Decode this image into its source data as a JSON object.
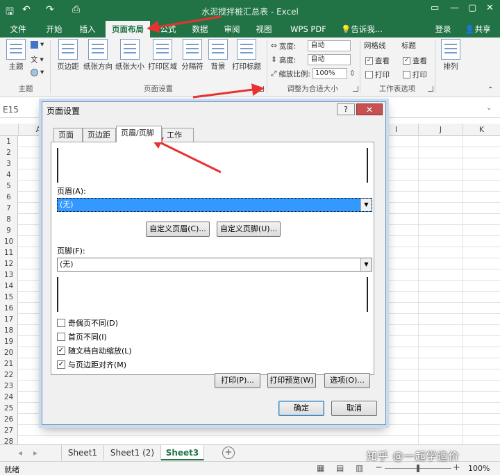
{
  "app": {
    "title": "水泥搅拌桩汇总表 - Excel",
    "accent": "#217346",
    "annotation_color": "#e8322f"
  },
  "quick_access": {
    "save_icon": "save-icon",
    "undo_icon": "undo-icon",
    "redo_icon": "redo-icon",
    "preview_icon": "print-preview-icon"
  },
  "menu": {
    "tabs": [
      "文件",
      "开始",
      "插入",
      "页面布局",
      "公式",
      "数据",
      "审阅",
      "视图",
      "WPS PDF"
    ],
    "active": "页面布局",
    "tell_me": "告诉我...",
    "login": "登录",
    "share": "共享"
  },
  "ribbon": {
    "theme_group": {
      "theme_label": "主题",
      "group_label": "主题",
      "text_label": "文"
    },
    "page_setup": {
      "buttons": [
        "页边距",
        "纸张方向",
        "纸张大小",
        "打印区域",
        "分隔符",
        "背景",
        "打印标题"
      ],
      "group_label": "页面设置"
    },
    "scale": {
      "width_label": "宽度:",
      "width_value": "自动",
      "height_label": "高度:",
      "height_value": "自动",
      "zoom_label": "缩放比例:",
      "zoom_value": "100%",
      "group_label": "调整为合适大小"
    },
    "sheet_options": {
      "gridlines_label": "网格线",
      "headings_label": "标题",
      "view_label": "查看",
      "print_label": "打印",
      "group_label": "工作表选项"
    },
    "arrange": {
      "label": "排列"
    }
  },
  "formula_bar": {
    "name_box": "E15"
  },
  "columns": [
    "A",
    "I",
    "J",
    "K"
  ],
  "rows": [
    "1",
    "2",
    "3",
    "4",
    "5",
    "6",
    "7",
    "8",
    "9",
    "10",
    "11",
    "12",
    "13",
    "14",
    "15",
    "16",
    "17",
    "18",
    "19",
    "20",
    "21",
    "22",
    "23",
    "24",
    "25",
    "26",
    "27",
    "28"
  ],
  "sheets": {
    "tabs": [
      "Sheet1",
      "Sheet1 (2)",
      "Sheet3"
    ],
    "active": "Sheet3"
  },
  "status": {
    "ready": "就绪",
    "zoom": "100%"
  },
  "dialog": {
    "title": "页面设置",
    "help": "?",
    "close": "✕",
    "tabs": [
      "页面",
      "页边距",
      "页眉/页脚",
      "工作表"
    ],
    "active_tab": "页眉/页脚",
    "header_label": "页眉(A):",
    "header_value": "(无)",
    "custom_header": "自定义页眉(C)...",
    "custom_footer": "自定义页脚(U)...",
    "footer_label": "页脚(F):",
    "footer_value": "(无)",
    "options": [
      {
        "label": "奇偶页不同(D)",
        "checked": false
      },
      {
        "label": "首页不同(I)",
        "checked": false
      },
      {
        "label": "随文档自动缩放(L)",
        "checked": true
      },
      {
        "label": "与页边距对齐(M)",
        "checked": true
      }
    ],
    "print_btn": "打印(P)...",
    "preview_btn": "打印预览(W)",
    "options_btn": "选项(O)...",
    "ok": "确定",
    "cancel": "取消"
  },
  "watermark": "知乎 @一起学造价"
}
